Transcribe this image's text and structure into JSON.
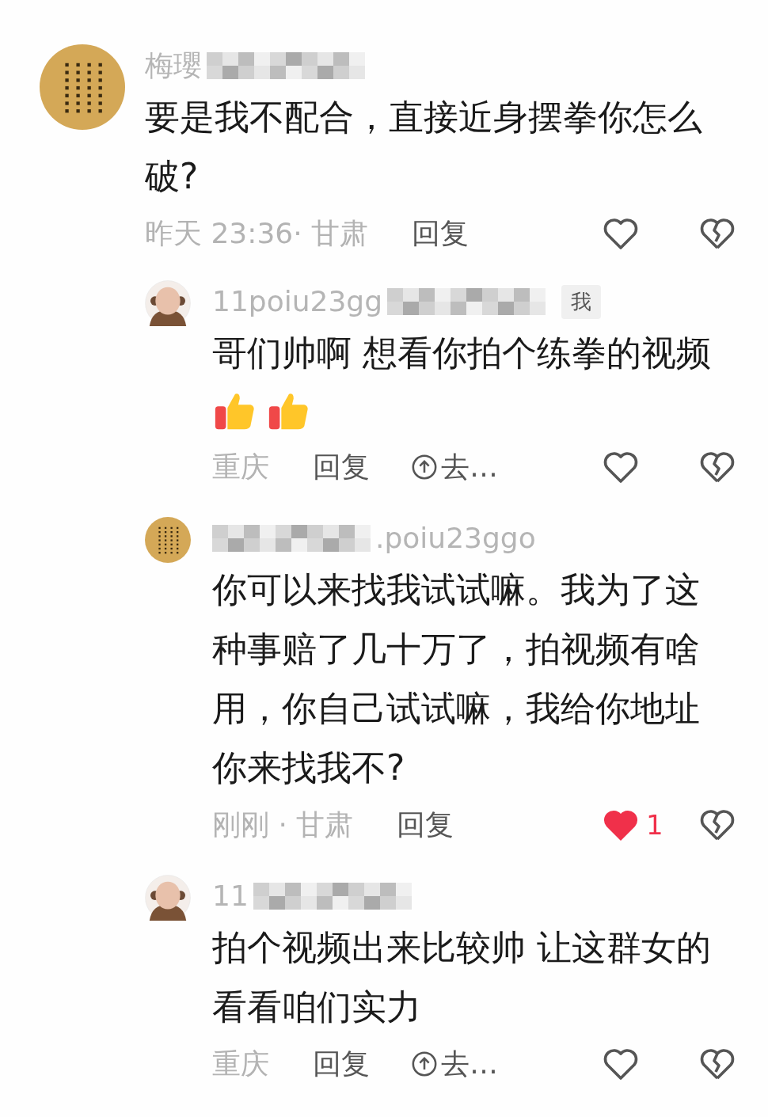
{
  "comments": [
    {
      "kind": "top",
      "avatar": {
        "kind": "scroll"
      },
      "name_prefix": "梅瓔",
      "lines": [
        "要是我不配合，直接近身摆拳你怎么破?"
      ],
      "meta": "昨天 23:36· 甘肃",
      "reply": "回复",
      "liked": false
    },
    {
      "kind": "reply",
      "avatar": {
        "kind": "figure"
      },
      "name_prefix": "11poiu23gg",
      "badge": "我",
      "lines": [
        "哥们帅啊 想看你拍个练拳的视频"
      ],
      "emojis": [
        {
          "kind": "thumbs-up"
        },
        {
          "kind": "thumbs-up"
        }
      ],
      "meta": "重庆",
      "reply": "回复",
      "extra": "去…",
      "liked": false
    },
    {
      "kind": "reply",
      "avatar": {
        "kind": "scroll"
      },
      "name_suffix": ".poiu23ggo",
      "lines": [
        "你可以来找我试试嘛。我为了这种事赔了几十万了，拍视频有啥用，你自己试试嘛，我给你地址你来找我不?"
      ],
      "meta": "刚刚 · 甘肃",
      "reply": "回复",
      "liked": true,
      "likes": "1"
    },
    {
      "kind": "reply",
      "avatar": {
        "kind": "figure"
      },
      "name_prefix": "11",
      "lines": [
        "拍个视频出来比较帅 让这群女的看看咱们实力"
      ],
      "meta": "重庆",
      "reply": "回复",
      "extra": "去…",
      "liked": false
    }
  ]
}
